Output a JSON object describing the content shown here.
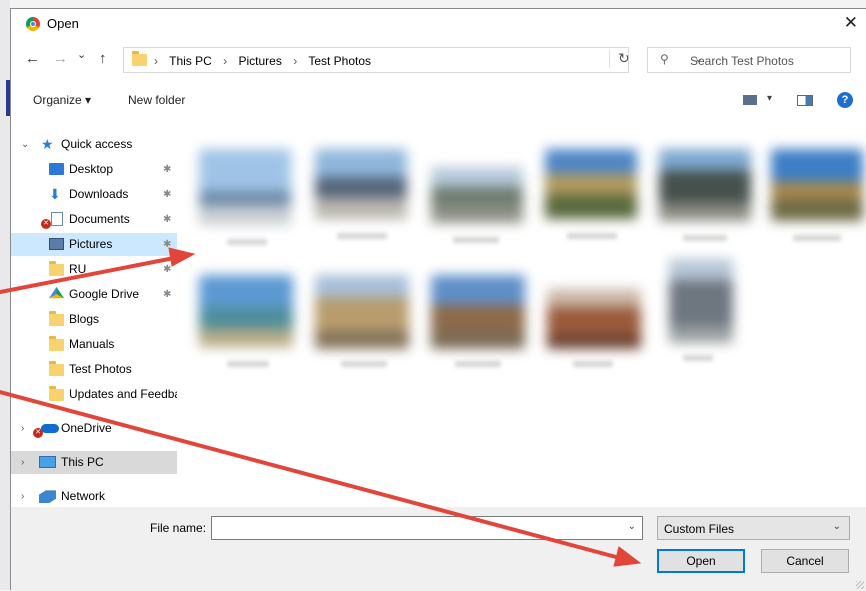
{
  "window": {
    "title": "Open",
    "close_glyph": "✕"
  },
  "nav": {
    "back_glyph": "←",
    "forward_glyph": "→",
    "recent_glyph": "⌄",
    "up_glyph": "↑",
    "breadcrumb": [
      "This PC",
      "Pictures",
      "Test Photos"
    ],
    "crumb_separator": "›",
    "dropdown_glyph": "⌄",
    "refresh_glyph": "↻",
    "search_placeholder": "Search Test Photos"
  },
  "toolbar": {
    "organize_label": "Organize ▾",
    "new_folder_label": "New folder",
    "help_glyph": "?",
    "view_glyph": "▾"
  },
  "sidebar": {
    "quick_access": "Quick access",
    "items": [
      {
        "label": "Desktop",
        "icon": "desktop-icon"
      },
      {
        "label": "Downloads",
        "icon": "download-arrow-icon"
      },
      {
        "label": "Documents",
        "icon": "documents-icon"
      },
      {
        "label": "Pictures",
        "icon": "pictures-icon"
      },
      {
        "label": "RU",
        "icon": "folder-icon"
      },
      {
        "label": "Google Drive",
        "icon": "google-drive-icon"
      },
      {
        "label": "Blogs",
        "icon": "folder-icon"
      },
      {
        "label": "Manuals",
        "icon": "folder-icon"
      },
      {
        "label": "Test Photos",
        "icon": "folder-icon"
      },
      {
        "label": "Updates and Feedba",
        "icon": "folder-icon"
      }
    ],
    "onedrive": "OneDrive",
    "this_pc": "This PC",
    "network": "Network",
    "pin_glyph": "✱"
  },
  "footer": {
    "file_name_label": "File name:",
    "file_name_value": "",
    "filter_value": "Custom Files",
    "open_label": "Open",
    "cancel_label": "Cancel"
  },
  "colors": {
    "annotation_arrow": "#e2453a",
    "selection": "#cce8ff",
    "accent": "#0078d7"
  }
}
